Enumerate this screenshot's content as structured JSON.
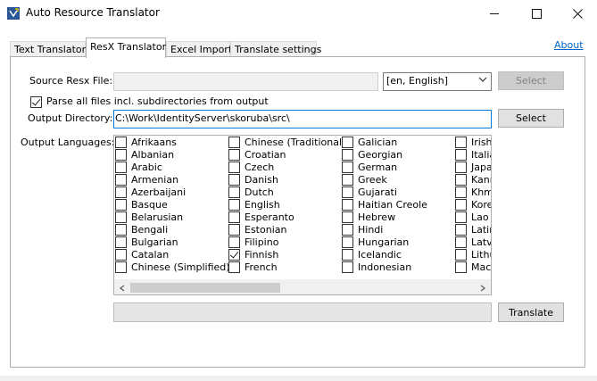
{
  "window": {
    "title": "Auto Resource Translator",
    "icon": "app-translate-icon"
  },
  "tabs": [
    {
      "label": "Text Translator",
      "active": false
    },
    {
      "label": "ResX Translator",
      "active": true
    },
    {
      "label": "Excel Import",
      "active": false
    },
    {
      "label": "Translate settings",
      "active": false
    }
  ],
  "about_label": "About",
  "form": {
    "source_label": "Source Resx File:",
    "source_value": "",
    "culture_selected": "[en, English]",
    "source_select_label": "Select",
    "parse_subdirs_label": "Parse all files incl. subdirectories from output",
    "parse_subdirs_checked": true,
    "output_dir_label": "Output Directory:",
    "output_dir_value": "C:\\Work\\IdentityServer\\skoruba\\src\\",
    "output_select_label": "Select",
    "output_languages_label": "Output Languages:",
    "translate_label": "Translate",
    "progress": 0
  },
  "languages": [
    [
      {
        "name": "Afrikaans",
        "checked": false
      },
      {
        "name": "Albanian",
        "checked": false
      },
      {
        "name": "Arabic",
        "checked": false
      },
      {
        "name": "Armenian",
        "checked": false
      },
      {
        "name": "Azerbaijani",
        "checked": false
      },
      {
        "name": "Basque",
        "checked": false
      },
      {
        "name": "Belarusian",
        "checked": false
      },
      {
        "name": "Bengali",
        "checked": false
      },
      {
        "name": "Bulgarian",
        "checked": false
      },
      {
        "name": "Catalan",
        "checked": false
      },
      {
        "name": "Chinese (Simplified)",
        "checked": false
      }
    ],
    [
      {
        "name": "Chinese (Traditional)",
        "checked": false
      },
      {
        "name": "Croatian",
        "checked": false
      },
      {
        "name": "Czech",
        "checked": false
      },
      {
        "name": "Danish",
        "checked": false
      },
      {
        "name": "Dutch",
        "checked": false
      },
      {
        "name": "English",
        "checked": false
      },
      {
        "name": "Esperanto",
        "checked": false
      },
      {
        "name": "Estonian",
        "checked": false
      },
      {
        "name": "Filipino",
        "checked": false
      },
      {
        "name": "Finnish",
        "checked": true
      },
      {
        "name": "French",
        "checked": false
      }
    ],
    [
      {
        "name": "Galician",
        "checked": false
      },
      {
        "name": "Georgian",
        "checked": false
      },
      {
        "name": "German",
        "checked": false
      },
      {
        "name": "Greek",
        "checked": false
      },
      {
        "name": "Gujarati",
        "checked": false
      },
      {
        "name": "Haitian Creole",
        "checked": false
      },
      {
        "name": "Hebrew",
        "checked": false
      },
      {
        "name": "Hindi",
        "checked": false
      },
      {
        "name": "Hungarian",
        "checked": false
      },
      {
        "name": "Icelandic",
        "checked": false
      },
      {
        "name": "Indonesian",
        "checked": false
      }
    ],
    [
      {
        "name": "Irish",
        "checked": false
      },
      {
        "name": "Italian",
        "checked": false
      },
      {
        "name": "Japanese",
        "checked": false
      },
      {
        "name": "Kannada",
        "checked": false
      },
      {
        "name": "Khmer",
        "checked": false
      },
      {
        "name": "Korean",
        "checked": false
      },
      {
        "name": "Lao",
        "checked": false
      },
      {
        "name": "Latin",
        "checked": false
      },
      {
        "name": "Latvian",
        "checked": false
      },
      {
        "name": "Lithuanian",
        "checked": false
      },
      {
        "name": "Macedonian",
        "checked": false
      }
    ]
  ],
  "colors": {
    "link": "#0066cc",
    "focus_border": "#0078d7"
  }
}
